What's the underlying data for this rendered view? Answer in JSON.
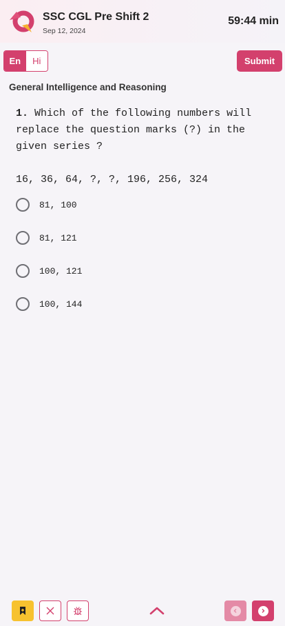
{
  "header": {
    "title": "SSC CGL Pre Shift 2",
    "date": "Sep 12, 2024",
    "timer": "59:44 min",
    "logo_icon": "q-logo-icon"
  },
  "toolbar": {
    "lang_en": "En",
    "lang_hi": "Hi",
    "selected_lang": "En",
    "submit_label": "Submit"
  },
  "section": "General Intelligence and Reasoning",
  "question": {
    "number": "1.",
    "text": "Which of the following numbers will replace the question marks (?) in the given series ?",
    "series": "16, 36, 64, ?, ?, 196, 256, 324",
    "options": [
      {
        "label": "81, 100"
      },
      {
        "label": "81, 121"
      },
      {
        "label": "100, 121"
      },
      {
        "label": "100, 144"
      }
    ]
  },
  "bottom_bar": {
    "icons": [
      "bookmark-icon",
      "close-icon",
      "bug-icon",
      "chevron-up-icon",
      "chevron-left-icon",
      "chevron-right-icon"
    ]
  },
  "colors": {
    "accent": "#d3406d",
    "bookmark": "#f7c22f",
    "background": "#f6f4f8"
  }
}
